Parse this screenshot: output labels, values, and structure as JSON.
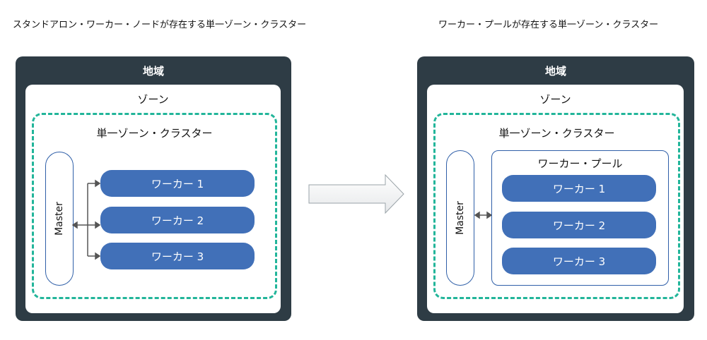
{
  "left": {
    "title": "スタンドアロン・ワーカー・ノードが存在する単一ゾーン・クラスター",
    "region": "地域",
    "zone": "ゾーン",
    "cluster": "単一ゾーン・クラスター",
    "master": "Master",
    "workers": [
      "ワーカー 1",
      "ワーカー 2",
      "ワーカー 3"
    ]
  },
  "right": {
    "title": "ワーカー・プールが存在する単一ゾーン・クラスター",
    "region": "地域",
    "zone": "ゾーン",
    "cluster": "単一ゾーン・クラスター",
    "pool": "ワーカー・プール",
    "master": "Master",
    "workers": [
      "ワーカー 1",
      "ワーカー 2",
      "ワーカー 3"
    ]
  },
  "colors": {
    "region": "#2e3c45",
    "cluster_border": "#22b59a",
    "worker": "#4170b8",
    "outline": "#2f5fa8"
  }
}
